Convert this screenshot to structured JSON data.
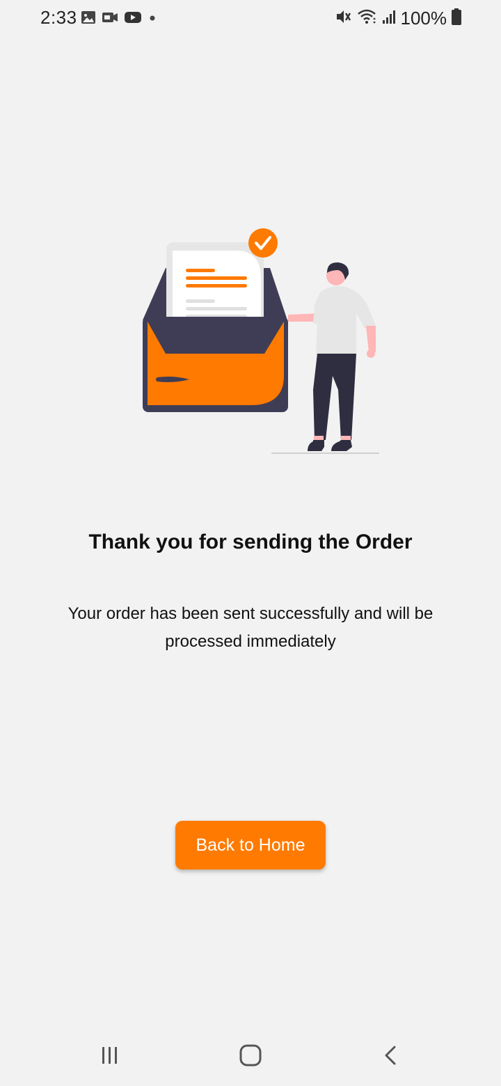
{
  "status_bar": {
    "time": "2:33",
    "battery_percent": "100%",
    "left_icons": [
      "image-icon",
      "camera-icon",
      "youtube-icon",
      "dot-icon"
    ],
    "right_icons": [
      "mute-icon",
      "wifi-icon",
      "signal-icon",
      "battery-icon"
    ]
  },
  "illustration": {
    "name": "order-sent-illustration",
    "colors": {
      "accent": "#ff7a00",
      "dark": "#3f3d56",
      "paper": "#ffffff",
      "paper_back": "#e6e6e6",
      "skin": "#ffb6b6",
      "pants": "#2f2e41",
      "shirt": "#e6e6e6"
    }
  },
  "main": {
    "title": "Thank you for sending the Order",
    "message": "Your order has been sent successfully and will be processed immediately",
    "button_label": "Back to Home"
  },
  "nav_bar": {
    "items": [
      "recent-apps-icon",
      "home-icon",
      "back-icon"
    ]
  },
  "colors": {
    "background": "#f2f2f2",
    "button": "#ff7a00",
    "button_text": "#ffffff"
  }
}
